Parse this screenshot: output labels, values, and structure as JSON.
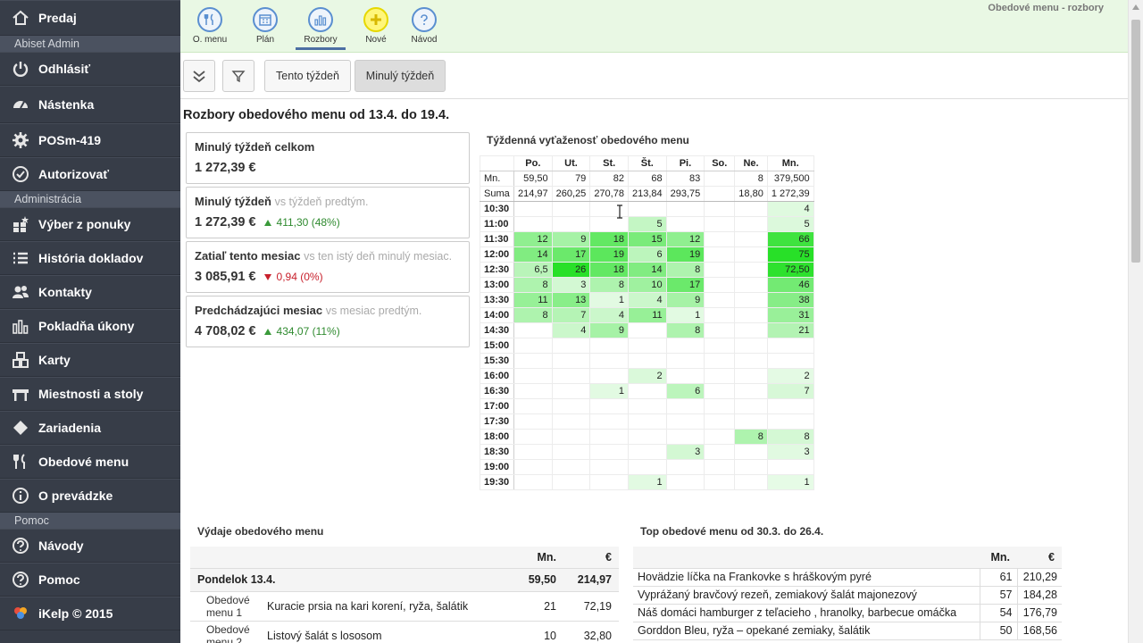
{
  "sidebar": {
    "top_item": "Predaj",
    "sections": [
      {
        "title": "Abiset Admin",
        "items": [
          {
            "label": "Odhlásiť",
            "icon": "power-icon"
          }
        ]
      },
      {
        "title": "",
        "items": [
          {
            "label": "Nástenka",
            "icon": "dashboard-icon"
          },
          {
            "label": "POSm-419",
            "icon": "gear-icon"
          },
          {
            "label": "Autorizovať",
            "icon": "check-circle-icon"
          }
        ]
      },
      {
        "title": "Administrácia",
        "items": [
          {
            "label": "Výber z ponuky",
            "icon": "menu-select-icon"
          },
          {
            "label": "História dokladov",
            "icon": "list-icon"
          },
          {
            "label": "Kontakty",
            "icon": "users-icon"
          },
          {
            "label": "Pokladňa úkony",
            "icon": "bar-chart-icon"
          },
          {
            "label": "Karty",
            "icon": "cards-icon"
          },
          {
            "label": "Miestnosti a stoly",
            "icon": "table-icon"
          },
          {
            "label": "Zariadenia",
            "icon": "diamond-icon"
          },
          {
            "label": "Obedové menu",
            "icon": "cutlery-icon"
          },
          {
            "label": "O prevádzke",
            "icon": "info-icon"
          }
        ]
      },
      {
        "title": "Pomoc",
        "items": [
          {
            "label": "Návody",
            "icon": "question-icon"
          },
          {
            "label": "Pomoc",
            "icon": "question-icon"
          },
          {
            "label": "iKelp © 2015",
            "icon": "ikelp-logo"
          }
        ]
      }
    ]
  },
  "toolbar": {
    "window_title": "Obedové menu - rozbory",
    "buttons": [
      {
        "label": "O. menu",
        "icon": "cutlery-icon"
      },
      {
        "label": "Plán",
        "icon": "calendar-icon"
      },
      {
        "label": "Rozbory",
        "icon": "chart-icon"
      },
      {
        "label": "Nové",
        "icon": "plus-icon"
      },
      {
        "label": "Návod",
        "icon": "question-icon"
      }
    ],
    "active": "Rozbory"
  },
  "filterbar": {
    "tab_this_week": "Tento týždeň",
    "tab_last_week": "Minulý týždeň",
    "selected": "Minulý týždeň"
  },
  "page_title": "Rozbory obedového menu od 13.4. do 19.4.",
  "stats": [
    {
      "title": "Minulý týždeň celkom",
      "muted": "",
      "value": "1 272,39 €",
      "delta": "",
      "dir": ""
    },
    {
      "title": "Minulý týždeň",
      "muted": "vs týždeň predtým.",
      "value": "1 272,39 €",
      "delta": "411,30 (48%)",
      "dir": "up"
    },
    {
      "title": "Zatiaľ tento mesiac",
      "muted": "vs ten istý deň minulý mesiac.",
      "value": "3 085,91 €",
      "delta": "0,94 (0%)",
      "dir": "down"
    },
    {
      "title": "Predchádzajúci mesiac",
      "muted": "vs mesiac predtým.",
      "value": "4 708,02 €",
      "delta": "434,07 (11%)",
      "dir": "up"
    }
  ],
  "heatmap": {
    "title": "Týždenná vyťaženosť obedového menu",
    "days": [
      "Po.",
      "Ut.",
      "St.",
      "Št.",
      "Pi.",
      "So.",
      "Ne.",
      "Mn."
    ],
    "summary_rows": [
      {
        "label": "Mn.",
        "values": [
          "59,50",
          "79",
          "82",
          "68",
          "83",
          "",
          "8",
          "379,500"
        ]
      },
      {
        "label": "Suma",
        "values": [
          "214,97",
          "260,25",
          "270,78",
          "213,84",
          "293,75",
          "",
          "18,80",
          "1 272,39"
        ]
      }
    ],
    "rows": [
      {
        "time": "10:30",
        "values": [
          "",
          "",
          "",
          "",
          "",
          "",
          "",
          "4"
        ]
      },
      {
        "time": "11:00",
        "values": [
          "",
          "",
          "",
          "5",
          "",
          "",
          "",
          "5"
        ]
      },
      {
        "time": "11:30",
        "values": [
          "12",
          "9",
          "18",
          "15",
          "12",
          "",
          "",
          "66"
        ]
      },
      {
        "time": "12:00",
        "values": [
          "14",
          "17",
          "19",
          "6",
          "19",
          "",
          "",
          "75"
        ]
      },
      {
        "time": "12:30",
        "values": [
          "6,5",
          "26",
          "18",
          "14",
          "8",
          "",
          "",
          "72,50"
        ]
      },
      {
        "time": "13:00",
        "values": [
          "8",
          "3",
          "8",
          "10",
          "17",
          "",
          "",
          "46"
        ]
      },
      {
        "time": "13:30",
        "values": [
          "11",
          "13",
          "1",
          "4",
          "9",
          "",
          "",
          "38"
        ]
      },
      {
        "time": "14:00",
        "values": [
          "8",
          "7",
          "4",
          "11",
          "1",
          "",
          "",
          "31"
        ]
      },
      {
        "time": "14:30",
        "values": [
          "",
          "4",
          "9",
          "",
          "8",
          "",
          "",
          "21"
        ]
      },
      {
        "time": "15:00",
        "values": [
          "",
          "",
          "",
          "",
          "",
          "",
          "",
          ""
        ]
      },
      {
        "time": "15:30",
        "values": [
          "",
          "",
          "",
          "",
          "",
          "",
          "",
          ""
        ]
      },
      {
        "time": "16:00",
        "values": [
          "",
          "",
          "",
          "2",
          "",
          "",
          "",
          "2"
        ]
      },
      {
        "time": "16:30",
        "values": [
          "",
          "",
          "1",
          "",
          "6",
          "",
          "",
          "7"
        ]
      },
      {
        "time": "17:00",
        "values": [
          "",
          "",
          "",
          "",
          "",
          "",
          "",
          ""
        ]
      },
      {
        "time": "17:30",
        "values": [
          "",
          "",
          "",
          "",
          "",
          "",
          "",
          ""
        ]
      },
      {
        "time": "18:00",
        "values": [
          "",
          "",
          "",
          "",
          "",
          "",
          "8",
          "8"
        ]
      },
      {
        "time": "18:30",
        "values": [
          "",
          "",
          "",
          "",
          "3",
          "",
          "",
          "3"
        ]
      },
      {
        "time": "19:00",
        "values": [
          "",
          "",
          "",
          "",
          "",
          "",
          "",
          ""
        ]
      },
      {
        "time": "19:30",
        "values": [
          "",
          "",
          "",
          "1",
          "",
          "",
          "",
          "1"
        ]
      }
    ]
  },
  "expenses": {
    "title": "Výdaje obedového menu",
    "headers": {
      "qty": "Mn.",
      "eur": "€"
    },
    "day": {
      "label": "Pondelok 13.4.",
      "qty": "59,50",
      "eur": "214,97"
    },
    "rows": [
      {
        "menu": "Obedové menu 1",
        "item": "Kuracie prsia na kari korení, ryža, šalátik",
        "qty": "21",
        "eur": "72,19"
      },
      {
        "menu": "Obedové menu 2",
        "item": "Listový šalát s lososom",
        "qty": "10",
        "eur": "32,80"
      }
    ]
  },
  "top_menus": {
    "title": "Top obedové menu od 30.3. do 26.4.",
    "headers": {
      "qty": "Mn.",
      "eur": "€"
    },
    "rows": [
      {
        "item": "Hovädzie líčka na Frankovke s hráškovým pyré",
        "qty": "61",
        "eur": "210,29"
      },
      {
        "item": "Vyprážaný bravčový rezeň, zemiakový šalát majonezový",
        "qty": "57",
        "eur": "184,28"
      },
      {
        "item": "Náš domáci hamburger z teľacieho , hranolky, barbecue omáčka",
        "qty": "54",
        "eur": "176,79"
      },
      {
        "item": "Gorddon Bleu, ryža – opekané zemiaky, šalátik",
        "qty": "50",
        "eur": "168,56"
      }
    ]
  },
  "colors": {
    "sidebar": "#373d48",
    "toolbar_bg": "#e9f8e4",
    "heat_max": "#2ee02e",
    "heat_min": "#e9fbe9",
    "up": "#2f8a2f",
    "down": "#c8202c"
  }
}
